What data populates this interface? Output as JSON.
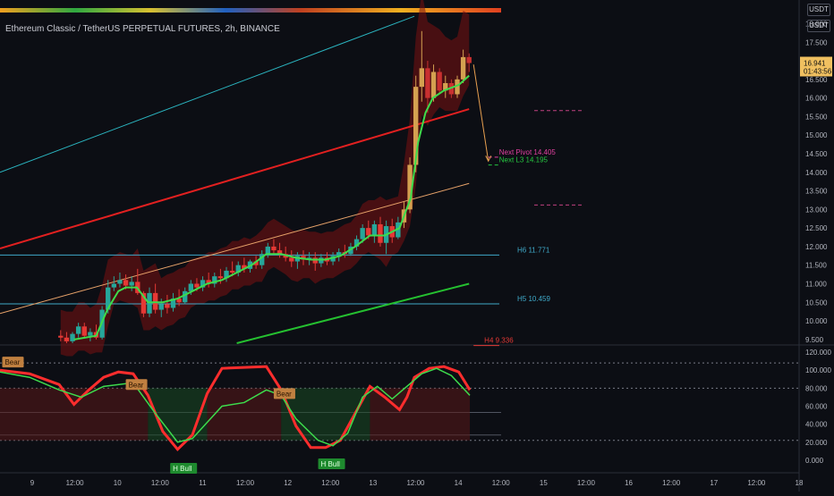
{
  "title": "Ethereum Classic / TetherUS PERPETUAL FUTURES, 2h, BINANCE",
  "currency_badges": [
    "USDT",
    "USDT"
  ],
  "price_tag": {
    "price": "16.941",
    "countdown": "01:43:56"
  },
  "colors": {
    "background": "#0c0e14",
    "bull": "#26a69a",
    "bear": "#e53935",
    "signal_up": "#3ddc4c",
    "signal_down": "#ff2d2d",
    "channel_top": "#2bb5c0",
    "channel_mid": "#e22020",
    "channel_low": "#e8a36a",
    "channel_bottom": "#25c030",
    "projection": "#e8a050"
  },
  "chart_data": [
    {
      "type": "candlestick",
      "title": "Ethereum Classic / TetherUS PERPETUAL FUTURES, 2h, BINANCE",
      "y_ticks": [
        "18.000",
        "17.500",
        "17.000",
        "16.500",
        "16.000",
        "15.500",
        "15.000",
        "14.500",
        "14.000",
        "13.500",
        "13.000",
        "12.500",
        "12.000",
        "11.500",
        "11.000",
        "10.500",
        "10.000",
        "9.500"
      ],
      "ylim": [
        9.4,
        18.3
      ],
      "x_ticks": [
        "9",
        "12:00",
        "10",
        "12:00",
        "11",
        "12:00",
        "12",
        "12:00",
        "13",
        "12:00",
        "14",
        "12:00",
        "15",
        "12:00",
        "16",
        "12:00",
        "17",
        "12:00",
        "18"
      ],
      "xlim": [
        0,
        108
      ],
      "candles": [
        {
          "x": 8.2,
          "o": 9.6,
          "h": 9.75,
          "l": 9.45,
          "c": 9.55
        },
        {
          "x": 9.0,
          "o": 9.55,
          "h": 9.7,
          "l": 9.4,
          "c": 9.45
        },
        {
          "x": 9.8,
          "o": 9.45,
          "h": 9.7,
          "l": 9.4,
          "c": 9.65
        },
        {
          "x": 10.6,
          "o": 9.65,
          "h": 9.95,
          "l": 9.55,
          "c": 9.85
        },
        {
          "x": 11.4,
          "o": 9.85,
          "h": 9.95,
          "l": 9.55,
          "c": 9.6
        },
        {
          "x": 12.2,
          "o": 9.6,
          "h": 9.8,
          "l": 9.45,
          "c": 9.7
        },
        {
          "x": 13.0,
          "o": 9.7,
          "h": 9.9,
          "l": 9.5,
          "c": 9.55
        },
        {
          "x": 13.8,
          "o": 9.55,
          "h": 10.4,
          "l": 9.5,
          "c": 10.3
        },
        {
          "x": 14.6,
          "o": 10.3,
          "h": 11.1,
          "l": 10.2,
          "c": 10.9
        },
        {
          "x": 15.4,
          "o": 10.9,
          "h": 11.2,
          "l": 10.8,
          "c": 11.0
        },
        {
          "x": 16.2,
          "o": 11.0,
          "h": 11.3,
          "l": 10.9,
          "c": 11.1
        },
        {
          "x": 17.0,
          "o": 11.1,
          "h": 11.25,
          "l": 10.85,
          "c": 10.95
        },
        {
          "x": 17.8,
          "o": 10.95,
          "h": 11.2,
          "l": 10.8,
          "c": 11.05
        },
        {
          "x": 18.6,
          "o": 11.05,
          "h": 11.4,
          "l": 10.7,
          "c": 10.75
        },
        {
          "x": 19.4,
          "o": 10.75,
          "h": 10.8,
          "l": 10.1,
          "c": 10.2
        },
        {
          "x": 20.2,
          "o": 10.2,
          "h": 10.9,
          "l": 10.1,
          "c": 10.75
        },
        {
          "x": 21.0,
          "o": 10.75,
          "h": 11.0,
          "l": 10.2,
          "c": 10.3
        },
        {
          "x": 21.8,
          "o": 10.3,
          "h": 10.6,
          "l": 10.1,
          "c": 10.45
        },
        {
          "x": 22.6,
          "o": 10.45,
          "h": 10.7,
          "l": 10.2,
          "c": 10.35
        },
        {
          "x": 23.4,
          "o": 10.35,
          "h": 10.75,
          "l": 10.25,
          "c": 10.6
        },
        {
          "x": 24.2,
          "o": 10.6,
          "h": 10.85,
          "l": 10.4,
          "c": 10.5
        },
        {
          "x": 25.0,
          "o": 10.5,
          "h": 10.9,
          "l": 10.45,
          "c": 10.8
        },
        {
          "x": 25.8,
          "o": 10.8,
          "h": 11.1,
          "l": 10.7,
          "c": 11.0
        },
        {
          "x": 26.6,
          "o": 11.0,
          "h": 11.15,
          "l": 10.8,
          "c": 10.9
        },
        {
          "x": 27.4,
          "o": 10.9,
          "h": 11.2,
          "l": 10.8,
          "c": 11.1
        },
        {
          "x": 28.2,
          "o": 11.1,
          "h": 11.3,
          "l": 10.9,
          "c": 11.0
        },
        {
          "x": 29.0,
          "o": 11.0,
          "h": 11.3,
          "l": 10.9,
          "c": 11.2
        },
        {
          "x": 29.8,
          "o": 11.2,
          "h": 11.4,
          "l": 11.0,
          "c": 11.15
        },
        {
          "x": 30.6,
          "o": 11.15,
          "h": 11.45,
          "l": 11.05,
          "c": 11.35
        },
        {
          "x": 31.4,
          "o": 11.35,
          "h": 11.6,
          "l": 11.2,
          "c": 11.3
        },
        {
          "x": 32.2,
          "o": 11.3,
          "h": 11.6,
          "l": 11.2,
          "c": 11.5
        },
        {
          "x": 33.0,
          "o": 11.5,
          "h": 11.7,
          "l": 11.3,
          "c": 11.4
        },
        {
          "x": 33.8,
          "o": 11.4,
          "h": 11.65,
          "l": 11.3,
          "c": 11.6
        },
        {
          "x": 34.6,
          "o": 11.6,
          "h": 11.75,
          "l": 11.4,
          "c": 11.5
        },
        {
          "x": 35.4,
          "o": 11.5,
          "h": 11.9,
          "l": 11.4,
          "c": 11.8
        },
        {
          "x": 36.2,
          "o": 11.8,
          "h": 12.1,
          "l": 11.7,
          "c": 12.0
        },
        {
          "x": 37.0,
          "o": 12.0,
          "h": 12.2,
          "l": 11.8,
          "c": 11.9
        },
        {
          "x": 37.8,
          "o": 11.9,
          "h": 12.1,
          "l": 11.7,
          "c": 11.8
        },
        {
          "x": 38.6,
          "o": 11.8,
          "h": 12.0,
          "l": 11.6,
          "c": 11.7
        },
        {
          "x": 39.4,
          "o": 11.7,
          "h": 11.9,
          "l": 11.45,
          "c": 11.6
        },
        {
          "x": 40.2,
          "o": 11.6,
          "h": 11.85,
          "l": 11.4,
          "c": 11.75
        },
        {
          "x": 41.0,
          "o": 11.75,
          "h": 11.9,
          "l": 11.5,
          "c": 11.65
        },
        {
          "x": 41.8,
          "o": 11.65,
          "h": 11.85,
          "l": 11.5,
          "c": 11.7
        },
        {
          "x": 42.6,
          "o": 11.7,
          "h": 11.85,
          "l": 11.35,
          "c": 11.55
        },
        {
          "x": 43.4,
          "o": 11.55,
          "h": 11.8,
          "l": 11.45,
          "c": 11.7
        },
        {
          "x": 44.2,
          "o": 11.7,
          "h": 11.85,
          "l": 11.5,
          "c": 11.6
        },
        {
          "x": 45.0,
          "o": 11.6,
          "h": 11.85,
          "l": 11.5,
          "c": 11.75
        },
        {
          "x": 45.8,
          "o": 11.75,
          "h": 11.95,
          "l": 11.6,
          "c": 11.85
        },
        {
          "x": 46.6,
          "o": 11.85,
          "h": 12.05,
          "l": 11.7,
          "c": 11.8
        },
        {
          "x": 47.4,
          "o": 11.8,
          "h": 12.1,
          "l": 11.75,
          "c": 12.0
        },
        {
          "x": 48.2,
          "o": 12.0,
          "h": 12.3,
          "l": 11.9,
          "c": 12.2
        },
        {
          "x": 49.0,
          "o": 12.2,
          "h": 12.6,
          "l": 12.1,
          "c": 12.5
        },
        {
          "x": 49.8,
          "o": 12.5,
          "h": 12.7,
          "l": 12.2,
          "c": 12.3
        },
        {
          "x": 50.6,
          "o": 12.3,
          "h": 12.7,
          "l": 12.1,
          "c": 12.6
        },
        {
          "x": 51.4,
          "o": 12.6,
          "h": 12.8,
          "l": 12.0,
          "c": 12.1
        },
        {
          "x": 52.2,
          "o": 12.1,
          "h": 12.7,
          "l": 11.8,
          "c": 12.55
        },
        {
          "x": 53.0,
          "o": 12.55,
          "h": 12.75,
          "l": 12.1,
          "c": 12.25
        },
        {
          "x": 53.8,
          "o": 12.25,
          "h": 12.8,
          "l": 12.2,
          "c": 12.65
        },
        {
          "x": 54.6,
          "o": 12.65,
          "h": 13.2,
          "l": 12.5,
          "c": 13.0
        },
        {
          "x": 55.4,
          "o": 13.0,
          "h": 14.4,
          "l": 12.9,
          "c": 14.2
        },
        {
          "x": 56.2,
          "o": 14.2,
          "h": 16.6,
          "l": 14.0,
          "c": 16.3
        },
        {
          "x": 57.0,
          "o": 16.3,
          "h": 17.8,
          "l": 15.9,
          "c": 16.8
        },
        {
          "x": 57.8,
          "o": 16.8,
          "h": 17.0,
          "l": 15.6,
          "c": 16.0
        },
        {
          "x": 58.6,
          "o": 16.0,
          "h": 16.9,
          "l": 15.9,
          "c": 16.7
        },
        {
          "x": 59.4,
          "o": 16.7,
          "h": 16.8,
          "l": 16.1,
          "c": 16.2
        },
        {
          "x": 60.2,
          "o": 16.2,
          "h": 16.6,
          "l": 16.0,
          "c": 16.4
        },
        {
          "x": 61.0,
          "o": 16.4,
          "h": 16.5,
          "l": 16.0,
          "c": 16.1
        },
        {
          "x": 61.8,
          "o": 16.1,
          "h": 16.6,
          "l": 16.0,
          "c": 16.5
        },
        {
          "x": 62.6,
          "o": 16.5,
          "h": 17.3,
          "l": 16.4,
          "c": 17.1
        },
        {
          "x": 63.4,
          "o": 17.1,
          "h": 17.2,
          "l": 16.7,
          "c": 16.94
        }
      ],
      "signal_line": [
        {
          "x": 10,
          "y": 9.5
        },
        {
          "x": 13,
          "y": 9.6
        },
        {
          "x": 14.5,
          "y": 10.3
        },
        {
          "x": 16,
          "y": 10.8
        },
        {
          "x": 17,
          "y": 10.9
        },
        {
          "x": 18.5,
          "y": 10.9
        },
        {
          "x": 20,
          "y": 10.5
        },
        {
          "x": 22,
          "y": 10.5
        },
        {
          "x": 24,
          "y": 10.6
        },
        {
          "x": 26,
          "y": 10.8
        },
        {
          "x": 28,
          "y": 11.0
        },
        {
          "x": 30,
          "y": 11.1
        },
        {
          "x": 32,
          "y": 11.3
        },
        {
          "x": 34,
          "y": 11.5
        },
        {
          "x": 36,
          "y": 11.8
        },
        {
          "x": 38,
          "y": 11.8
        },
        {
          "x": 40,
          "y": 11.7
        },
        {
          "x": 42,
          "y": 11.65
        },
        {
          "x": 44,
          "y": 11.65
        },
        {
          "x": 46,
          "y": 11.75
        },
        {
          "x": 48,
          "y": 12.0
        },
        {
          "x": 50,
          "y": 12.3
        },
        {
          "x": 52,
          "y": 12.3
        },
        {
          "x": 54,
          "y": 12.5
        },
        {
          "x": 55.5,
          "y": 13.3
        },
        {
          "x": 56.5,
          "y": 14.8
        },
        {
          "x": 57.5,
          "y": 15.6
        },
        {
          "x": 58.5,
          "y": 16.0
        },
        {
          "x": 60,
          "y": 16.2
        },
        {
          "x": 62,
          "y": 16.35
        },
        {
          "x": 63.4,
          "y": 16.6
        }
      ],
      "channel_lines": [
        {
          "name": "top",
          "from": {
            "x": 0,
            "y": 14.0
          },
          "to": {
            "x": 56,
            "y": 18.2
          }
        },
        {
          "name": "mid",
          "from": {
            "x": 0,
            "y": 11.95
          },
          "to": {
            "x": 63.4,
            "y": 15.7
          }
        },
        {
          "name": "low",
          "from": {
            "x": 0,
            "y": 10.2
          },
          "to": {
            "x": 63.4,
            "y": 13.7
          }
        },
        {
          "name": "bottom",
          "from": {
            "x": 32,
            "y": 9.4
          },
          "to": {
            "x": 63.4,
            "y": 11.0
          }
        }
      ],
      "levels": [
        {
          "label": "H6 11.771",
          "value": 11.771,
          "color": "#3fa9c9",
          "style": "solid",
          "from_x": 0
        },
        {
          "label": "H5 10.459",
          "value": 10.459,
          "color": "#3fa9c9",
          "style": "solid",
          "from_x": 0
        },
        {
          "label": "H4 9.336",
          "value": 9.336,
          "color": "#e53935",
          "style": "solid",
          "from_x": 64
        },
        {
          "label": "Next Pivot 14.405",
          "value": 14.405,
          "color": "#e040a0",
          "style": "dashed",
          "from_x": 66
        },
        {
          "label": "Next L3 14.195",
          "value": 14.195,
          "color": "#26c640",
          "style": "dashed",
          "from_x": 66
        }
      ],
      "pink_dashed_levels": [
        15.66,
        13.12
      ],
      "projection_arrow": {
        "from": {
          "x": 64,
          "y": 16.9
        },
        "to": {
          "x": 66,
          "y": 14.3
        }
      }
    },
    {
      "type": "line",
      "y_ticks": [
        "120.000",
        "100.000",
        "80.000",
        "60.000",
        "40.000",
        "20.000",
        "0.000"
      ],
      "ylim": [
        -12,
        126
      ],
      "dotted_levels": [
        108,
        80,
        22
      ],
      "solid_levels": [
        53,
        28
      ],
      "series": [
        {
          "name": "",
          "color": "#ff2d2d",
          "values": [
            {
              "x": 0,
              "y": 100
            },
            {
              "x": 4,
              "y": 96
            },
            {
              "x": 8,
              "y": 84
            },
            {
              "x": 10,
              "y": 62
            },
            {
              "x": 12,
              "y": 78
            },
            {
              "x": 14,
              "y": 92
            },
            {
              "x": 16,
              "y": 98
            },
            {
              "x": 18,
              "y": 96
            },
            {
              "x": 20,
              "y": 72
            },
            {
              "x": 22,
              "y": 32
            },
            {
              "x": 24,
              "y": 12
            },
            {
              "x": 26,
              "y": 28
            },
            {
              "x": 28,
              "y": 74
            },
            {
              "x": 30,
              "y": 102
            },
            {
              "x": 33,
              "y": 103
            },
            {
              "x": 36,
              "y": 104
            },
            {
              "x": 38,
              "y": 78
            },
            {
              "x": 40,
              "y": 38
            },
            {
              "x": 42,
              "y": 14
            },
            {
              "x": 44,
              "y": 14
            },
            {
              "x": 46,
              "y": 22
            },
            {
              "x": 48,
              "y": 52
            },
            {
              "x": 50,
              "y": 82
            },
            {
              "x": 52,
              "y": 70
            },
            {
              "x": 54,
              "y": 56
            },
            {
              "x": 55,
              "y": 70
            },
            {
              "x": 56,
              "y": 92
            },
            {
              "x": 58,
              "y": 102
            },
            {
              "x": 60,
              "y": 104
            },
            {
              "x": 62,
              "y": 98
            },
            {
              "x": 63.5,
              "y": 78
            }
          ]
        },
        {
          "name": "",
          "color": "#3ddc4c",
          "values": [
            {
              "x": 0,
              "y": 98
            },
            {
              "x": 4,
              "y": 92
            },
            {
              "x": 8,
              "y": 78
            },
            {
              "x": 11,
              "y": 70
            },
            {
              "x": 14,
              "y": 82
            },
            {
              "x": 18,
              "y": 86
            },
            {
              "x": 21,
              "y": 52
            },
            {
              "x": 24,
              "y": 20
            },
            {
              "x": 26,
              "y": 24
            },
            {
              "x": 28,
              "y": 42
            },
            {
              "x": 30,
              "y": 60
            },
            {
              "x": 33,
              "y": 64
            },
            {
              "x": 36,
              "y": 78
            },
            {
              "x": 38,
              "y": 72
            },
            {
              "x": 40,
              "y": 46
            },
            {
              "x": 43,
              "y": 22
            },
            {
              "x": 45,
              "y": 16
            },
            {
              "x": 47,
              "y": 30
            },
            {
              "x": 49,
              "y": 70
            },
            {
              "x": 51,
              "y": 82
            },
            {
              "x": 53,
              "y": 68
            },
            {
              "x": 55,
              "y": 82
            },
            {
              "x": 57,
              "y": 96
            },
            {
              "x": 59,
              "y": 102
            },
            {
              "x": 61,
              "y": 94
            },
            {
              "x": 63.5,
              "y": 72
            }
          ]
        }
      ],
      "markers": [
        {
          "text": "Bear",
          "x": 0.3,
          "y": 109,
          "kind": "bear"
        },
        {
          "text": "Bear",
          "x": 17,
          "y": 84,
          "kind": "bear"
        },
        {
          "text": "Bear",
          "x": 37,
          "y": 74,
          "kind": "bear"
        },
        {
          "text": "H Bull",
          "x": 23,
          "y": -9,
          "kind": "bull"
        },
        {
          "text": "H Bull",
          "x": 43,
          "y": -4,
          "kind": "bull"
        }
      ]
    }
  ]
}
